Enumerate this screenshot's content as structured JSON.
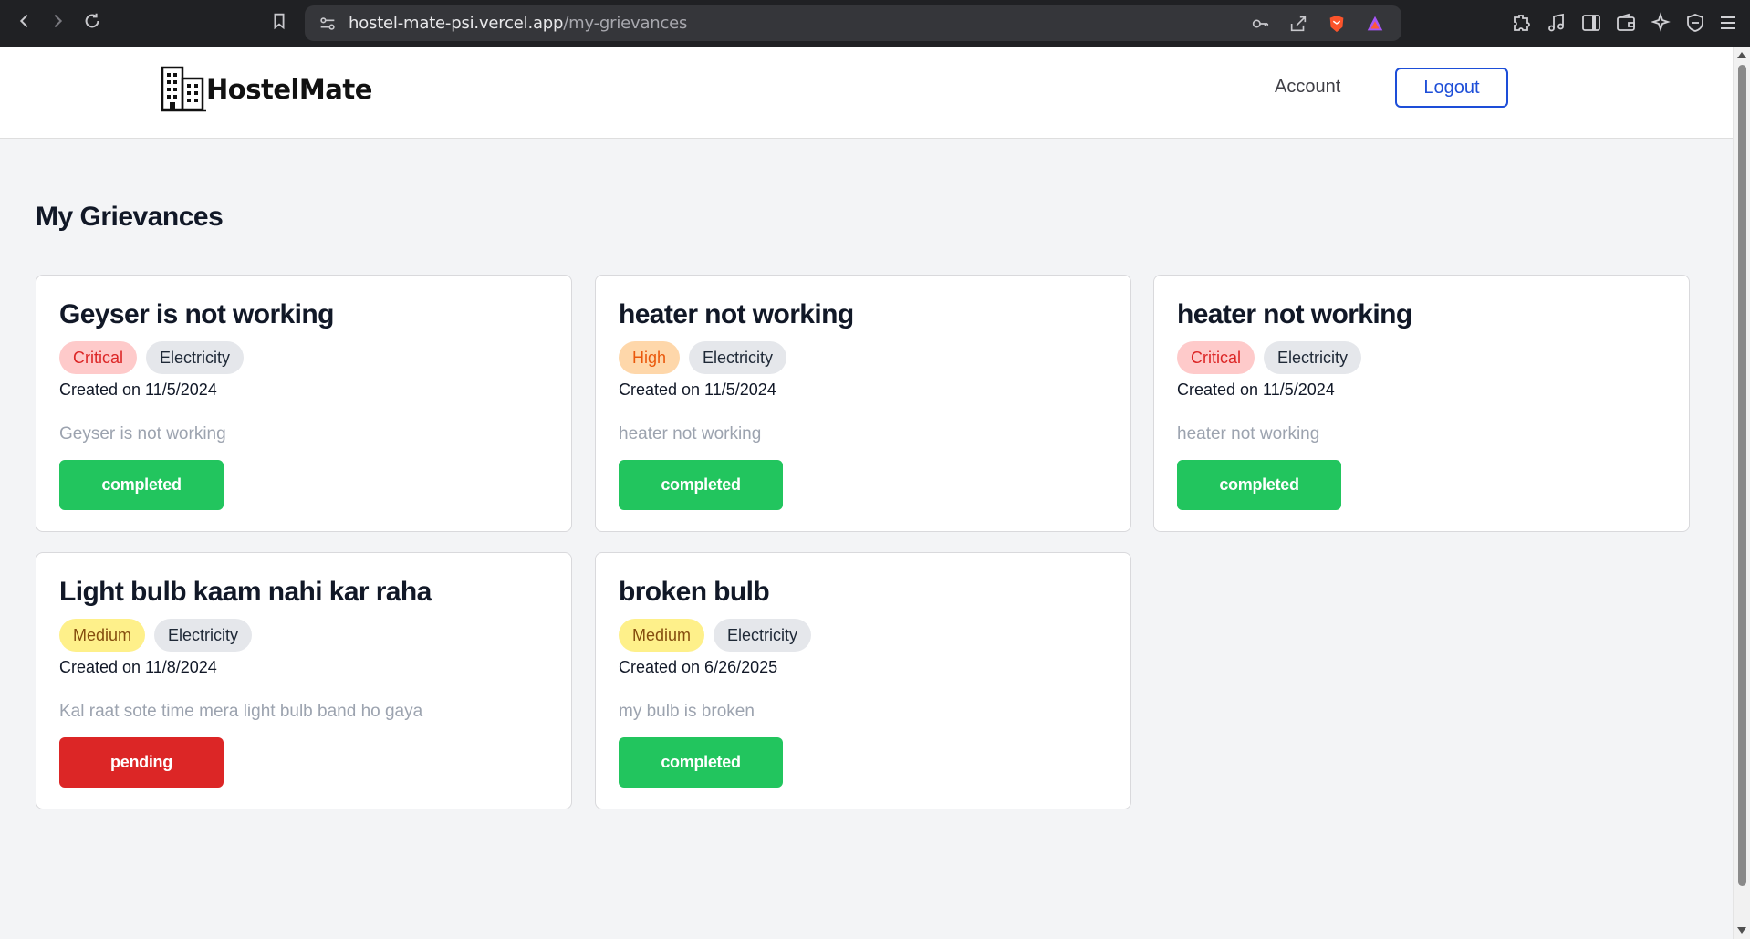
{
  "browser": {
    "url_host": "hostel-mate-psi.vercel.app",
    "url_path": "/my-grievances"
  },
  "header": {
    "logo_text": "HostelMate",
    "account_label": "Account",
    "logout_label": "Logout"
  },
  "page": {
    "title": "My Grievances"
  },
  "grievances": [
    {
      "title": "Geyser is not working",
      "priority": "Critical",
      "category": "Electricity",
      "created": "Created on 11/5/2024",
      "description": "Geyser is not working",
      "status": "completed"
    },
    {
      "title": "heater not working",
      "priority": "High",
      "category": "Electricity",
      "created": "Created on 11/5/2024",
      "description": "heater not working",
      "status": "completed"
    },
    {
      "title": "heater not working",
      "priority": "Critical",
      "category": "Electricity",
      "created": "Created on 11/5/2024",
      "description": "heater not working",
      "status": "completed"
    },
    {
      "title": "Light bulb kaam nahi kar raha",
      "priority": "Medium",
      "category": "Electricity",
      "created": "Created on 11/8/2024",
      "description": "Kal raat sote time mera light bulb band ho gaya",
      "status": "pending"
    },
    {
      "title": "broken bulb",
      "priority": "Medium",
      "category": "Electricity",
      "created": "Created on 6/26/2025",
      "description": "my bulb is broken",
      "status": "completed"
    }
  ],
  "colors": {
    "critical_bg": "#fecaca",
    "high_bg": "#fed7aa",
    "medium_bg": "#fef08a",
    "completed": "#22c55e",
    "pending": "#dc2626",
    "accent": "#1d4ed8"
  }
}
